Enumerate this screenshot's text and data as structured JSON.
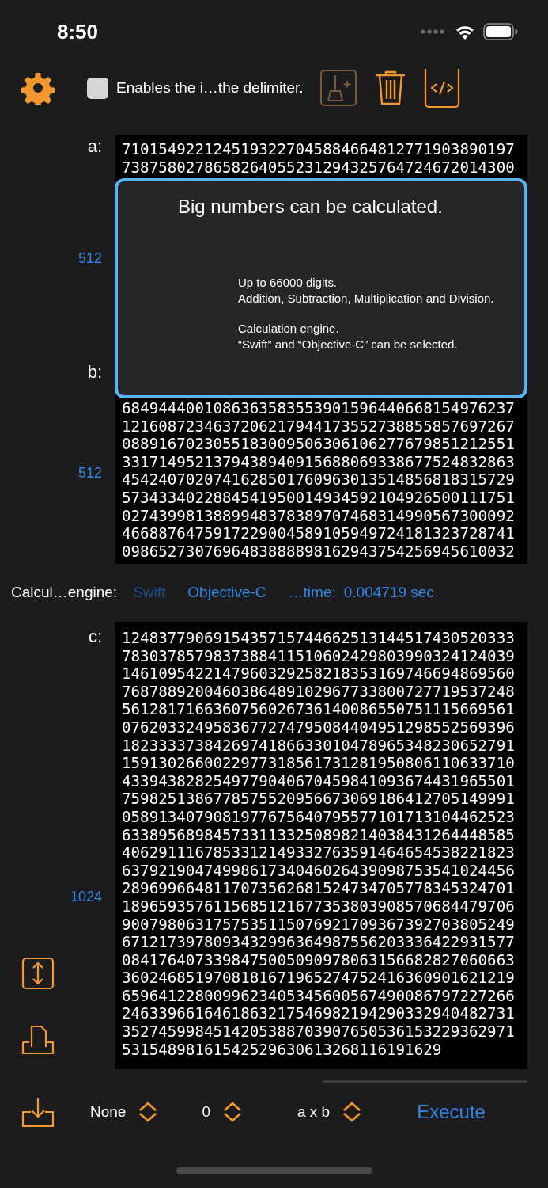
{
  "status_bar": {
    "time": "8:50"
  },
  "toolbar": {
    "delimiter_option": {
      "label": "Enables the i…the delimiter.",
      "checked": false
    },
    "buttons": [
      {
        "kind": "clean",
        "disabled": true
      },
      {
        "kind": "trash",
        "disabled": false
      },
      {
        "kind": "code",
        "disabled": false
      }
    ]
  },
  "operands": [
    {
      "label": "a:",
      "digit_count": "512",
      "lines": [
        "7101549221245193227045884664812771903890197",
        "7387580278658264055231294325764724672014300"
      ]
    },
    {
      "label": "b:",
      "digit_count": "512",
      "lines": [
        "6849444001086363583553901596440668154976237",
        "1216087234637206217944173552738855857697267",
        "0889167023055183009506306106277679851212551",
        "3317149521379438940915688069338677524832863",
        "4542407020741628501760963013514856818315729",
        "5734334022884541950014934592104926500111751",
        "0274399813889948378389707468314990567300092",
        "4668876475917229004589105949724181323728741",
        "0986527307696483888898162943754256945610032"
      ]
    }
  ],
  "tooltip": {
    "title": "Big numbers can be calculated.",
    "paragraphs": [
      [
        "Up to 66000 digits.",
        "Addition, Subtraction, Multiplication and Division."
      ],
      [
        "Calculation engine.",
        "“Swift” and “Objective-C” can be selected."
      ]
    ]
  },
  "engine": {
    "label": "Calcul…engine:",
    "options": [
      {
        "label": "Swift",
        "disabled": true
      },
      {
        "label": "Objective-C",
        "disabled": false
      }
    ],
    "time_label": "…time:",
    "time_value": "0.004719 sec"
  },
  "result": {
    "label": "c:",
    "digit_count": "1024",
    "lines": [
      "1248377906915435715744662513144517430520333",
      "7830378579837388411510602429803990324124039",
      "1461095422147960329258218353169746694869560",
      "7687889200460386489102967733800727719537248",
      "5612817166360756026736140086550751115669561",
      "0762033249583677274795084404951298552569396",
      "1823333738426974186633010478965348230652791",
      "1591302660022977318561731281950806110633710",
      "4339438282549779040670459841093674431965501",
      "7598251386778575520956673069186412705149991",
      "0589134079081977675640795577101713104462523",
      "6338956898457331133250898214038431264448585",
      "4062911167853312149332763591464654538221823",
      "6379219047499861734046026439098753541024456",
      "2896996648117073562681524734705778345324701",
      "1896593576115685121677353803908570684479706",
      "9007980631757535115076921709367392703805249",
      "6712173978093432996364987556203336422931577",
      "0841764073398475005090978063156682827060663",
      "3602468519708181671965274752416360901621219",
      "6596412280099623405345600567490086797227266",
      "2463396616461863217546982194290332940482731",
      "3527459984514205388703907650536153229362971",
      "53154898161542529630613268116191629"
    ]
  },
  "bottom_bar": {
    "pickers": [
      {
        "value": "None"
      },
      {
        "value": "0"
      },
      {
        "value": "a x b"
      }
    ],
    "execute": "Execute"
  }
}
